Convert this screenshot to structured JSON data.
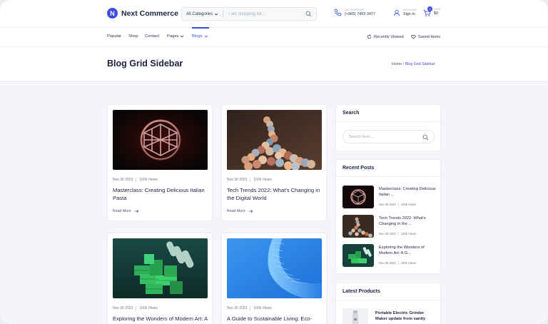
{
  "brand": {
    "name": "Next Commerce",
    "mark": "N"
  },
  "search": {
    "category": "All Categories",
    "placeholder": "I am shopping for..."
  },
  "support": {
    "label": "24/7 SUPPORT",
    "phone": "(+965) 7492-3477"
  },
  "account": {
    "label": "ACCOUNT",
    "action": "Sign In"
  },
  "cart": {
    "label": "CART",
    "total": "$0",
    "count": "0"
  },
  "nav": {
    "items": [
      {
        "label": "Popular"
      },
      {
        "label": "Shop"
      },
      {
        "label": "Contact"
      },
      {
        "label": "Pages"
      },
      {
        "label": "Blogs"
      }
    ],
    "recently_viewed": "Recently Viewed",
    "saved_items": "Saved Items"
  },
  "page": {
    "title": "Blog Grid Sidebar",
    "breadcrumb_home": "Home",
    "breadcrumb_sep": "/",
    "breadcrumb_current": "Blog Grid Sidebar"
  },
  "posts": [
    {
      "date": "Nov 30 2023",
      "views": "100k Views",
      "title": "Masterclass: Creating Delicious Italian Pasta",
      "read_more": "Read More"
    },
    {
      "date": "Nov 30 2023",
      "views": "100k Views",
      "title": "Tech Trends 2022: What's Changing in the Digital World",
      "read_more": "Read More"
    },
    {
      "date": "Nov 30 2023",
      "views": "100k Views",
      "title": "Exploring the Wonders of Modern Art: A Gallery Tour"
    },
    {
      "date": "Nov 30 2023",
      "views": "100k Views",
      "title": "A Guide to Sustainable Living: Eco-Friendly Tips"
    }
  ],
  "sidebar": {
    "search_title": "Search",
    "search_placeholder": "Search here...",
    "recent_title": "Recent Posts",
    "recent": [
      {
        "title": "Masterclass: Creating Delicious Italian ...",
        "date": "Nov 30 2023",
        "views": "100k Views"
      },
      {
        "title": "Tech Trends 2022: What's Changing in the ...",
        "date": "Nov 30 2023",
        "views": "100k Views"
      },
      {
        "title": "Exploring the Wonders of Modern Art: A G...",
        "date": "Nov 30 2023",
        "views": "100k Views"
      }
    ],
    "products_title": "Latest Products",
    "products": [
      {
        "title": "Portable Electric Grinder Maker update from sanity"
      }
    ]
  },
  "colors": {
    "accent": "#3b4de0",
    "text": "#1c2340",
    "muted": "#6f778a",
    "page_bg": "#f3f5f8"
  }
}
